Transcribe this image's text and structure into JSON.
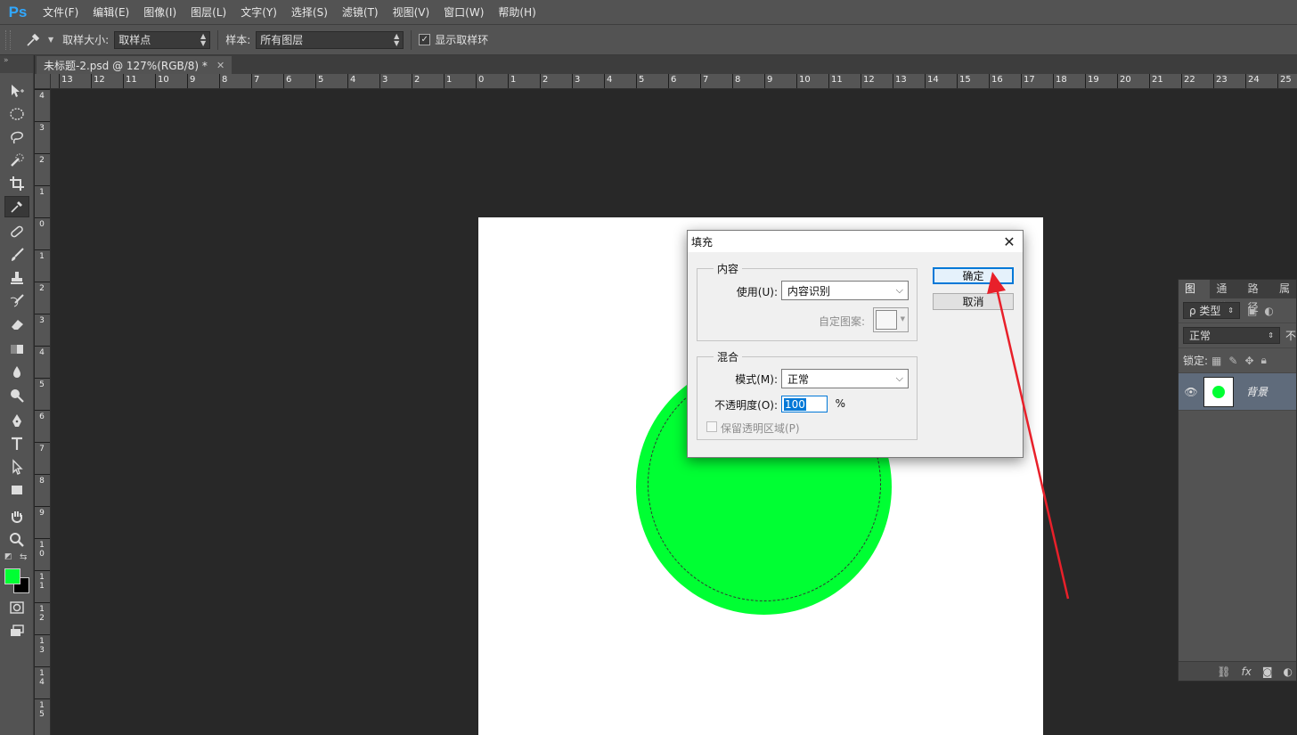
{
  "app": {
    "logo": "Ps"
  },
  "menu": [
    "文件(F)",
    "编辑(E)",
    "图像(I)",
    "图层(L)",
    "文字(Y)",
    "选择(S)",
    "滤镜(T)",
    "视图(V)",
    "窗口(W)",
    "帮助(H)"
  ],
  "options": {
    "sample_size_label": "取样大小:",
    "sample_size_value": "取样点",
    "sample_label": "样本:",
    "sample_value": "所有图层",
    "show_ring_label": "显示取样环",
    "show_ring_checked": true
  },
  "document": {
    "tab_title": "未标题-2.psd @ 127%(RGB/8) *",
    "canvas_color": "#ffffff",
    "circle_color": "#00ff33"
  },
  "ruler": {
    "h_labels": [
      "13",
      "12",
      "11",
      "10",
      "9",
      "8",
      "7",
      "6",
      "5",
      "4",
      "3",
      "2",
      "1",
      "0",
      "1",
      "2",
      "3",
      "4",
      "5",
      "6",
      "7",
      "8",
      "9",
      "10",
      "11",
      "12",
      "13",
      "14",
      "15",
      "16",
      "17",
      "18",
      "19",
      "20",
      "21",
      "22",
      "23",
      "24",
      "25"
    ],
    "v_labels": [
      "4",
      "3",
      "2",
      "1",
      "0",
      "1",
      "2",
      "3",
      "4",
      "5",
      "6",
      "7",
      "8",
      "9",
      "10",
      "11",
      "12",
      "13",
      "14",
      "15"
    ]
  },
  "tools": [
    "move-tool-icon",
    "elliptical-marquee-icon",
    "lasso-icon",
    "quick-selection-icon",
    "crop-icon",
    "eyedropper-icon",
    "healing-brush-icon",
    "brush-icon",
    "clone-stamp-icon",
    "history-brush-icon",
    "eraser-icon",
    "gradient-icon",
    "blur-icon",
    "dodge-icon",
    "pen-icon",
    "type-icon",
    "path-selection-icon",
    "rectangle-icon",
    "hand-icon",
    "zoom-icon"
  ],
  "colors": {
    "foreground": "#00ff33",
    "background": "#000000",
    "accent": "#0078d7",
    "arrow": "#e8202a"
  },
  "layers_panel": {
    "tabs": [
      "图层",
      "通道",
      "路径",
      "属"
    ],
    "filter_label": "ρ 类型",
    "blend_mode": "正常",
    "opacity_short": "不",
    "lock_label": "锁定:",
    "layer_name": "背景"
  },
  "dialog": {
    "title": "填充",
    "content_group": "内容",
    "use_label": "使用(U):",
    "use_value": "内容识别",
    "custom_pattern_label": "自定图案:",
    "blend_group": "混合",
    "mode_label": "模式(M):",
    "mode_value": "正常",
    "opacity_label": "不透明度(O):",
    "opacity_value": "100",
    "percent": "%",
    "preserve_label": "保留透明区域(P)",
    "ok_label": "确定",
    "cancel_label": "取消"
  }
}
